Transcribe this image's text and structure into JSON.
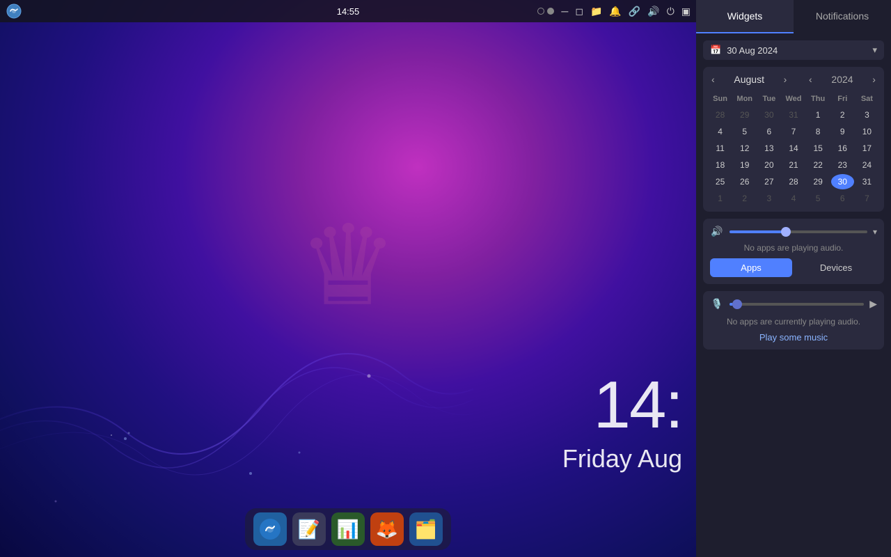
{
  "taskbar": {
    "time": "14:55",
    "dots": [
      "empty",
      "filled"
    ]
  },
  "clock": {
    "time": "14:",
    "date": "Friday Aug"
  },
  "panel": {
    "tabs": [
      {
        "label": "Widgets",
        "id": "widgets",
        "active": true
      },
      {
        "label": "Notifications",
        "id": "notifications",
        "active": false
      }
    ],
    "date_selector": {
      "text": "30 Aug 2024",
      "icon": "📅"
    },
    "calendar": {
      "month": "August",
      "nav_left": "‹",
      "nav_right": "›",
      "year": "2024",
      "year_nav_left": "‹",
      "year_nav_right": "›",
      "day_headers": [
        "Sun",
        "Mon",
        "Tue",
        "Wed",
        "Thu",
        "Fri",
        "Sat"
      ],
      "weeks": [
        [
          {
            "d": "28",
            "other": true
          },
          {
            "d": "29",
            "other": true
          },
          {
            "d": "30",
            "other": true
          },
          {
            "d": "31",
            "other": true
          },
          {
            "d": "1"
          },
          {
            "d": "2"
          },
          {
            "d": "3"
          }
        ],
        [
          {
            "d": "4"
          },
          {
            "d": "5"
          },
          {
            "d": "6"
          },
          {
            "d": "7"
          },
          {
            "d": "8"
          },
          {
            "d": "9"
          },
          {
            "d": "10"
          }
        ],
        [
          {
            "d": "11"
          },
          {
            "d": "12"
          },
          {
            "d": "13"
          },
          {
            "d": "14"
          },
          {
            "d": "15"
          },
          {
            "d": "16"
          },
          {
            "d": "17"
          }
        ],
        [
          {
            "d": "18"
          },
          {
            "d": "19"
          },
          {
            "d": "20"
          },
          {
            "d": "21"
          },
          {
            "d": "22"
          },
          {
            "d": "23"
          },
          {
            "d": "24"
          }
        ],
        [
          {
            "d": "25"
          },
          {
            "d": "26"
          },
          {
            "d": "27"
          },
          {
            "d": "28"
          },
          {
            "d": "29"
          },
          {
            "d": "30",
            "today": true
          },
          {
            "d": "31"
          }
        ],
        [
          {
            "d": "1",
            "other": true
          },
          {
            "d": "2",
            "other": true
          },
          {
            "d": "3",
            "other": true
          },
          {
            "d": "4",
            "other": true
          },
          {
            "d": "5",
            "other": true
          },
          {
            "d": "6",
            "other": true
          },
          {
            "d": "7",
            "other": true
          }
        ]
      ]
    },
    "volume": {
      "no_audio_text": "No apps are playing audio.",
      "apps_tab": "Apps",
      "devices_tab": "Devices",
      "volume_percent": 40
    },
    "microphone": {
      "no_current_audio": "No apps are currently playing audio.",
      "play_music_label": "Play some music",
      "mic_percent": 2
    }
  },
  "dock": {
    "items": [
      {
        "label": "Steambird",
        "icon": "🐦",
        "color": "#2080c0"
      },
      {
        "label": "Text Editor",
        "icon": "📝",
        "color": "#404060"
      },
      {
        "label": "Sheets",
        "icon": "📊",
        "color": "#3a7a3a"
      },
      {
        "label": "Firefox",
        "icon": "🦊",
        "color": "#e06020"
      },
      {
        "label": "Files",
        "icon": "🗂️",
        "color": "#4080c0"
      }
    ]
  }
}
